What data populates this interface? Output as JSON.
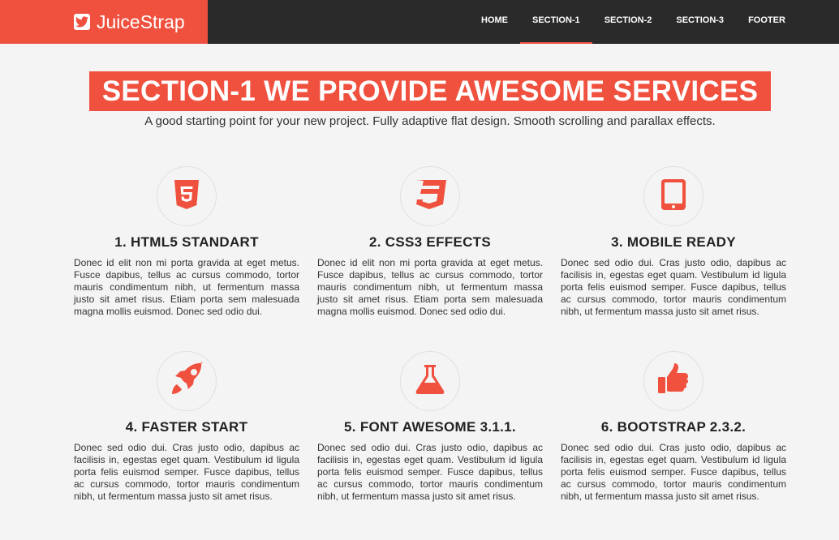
{
  "brand": {
    "name": "JuiceStrap",
    "icon": "twitter-icon"
  },
  "nav": {
    "items": [
      {
        "label": "HOME",
        "active": false
      },
      {
        "label": "SECTION-1",
        "active": true
      },
      {
        "label": "SECTION-2",
        "active": false
      },
      {
        "label": "SECTION-3",
        "active": false
      },
      {
        "label": "FOOTER",
        "active": false
      }
    ]
  },
  "hero": {
    "title": "SECTION-1 WE PROVIDE AWESOME SERVICES",
    "subtitle": "A good starting point for your new project. Fully adaptive flat design. Smooth scrolling and parallax effects."
  },
  "features": [
    {
      "icon": "html5-icon",
      "title": "1. HTML5 STANDART",
      "text": "Donec id elit non mi porta gravida at eget metus. Fusce dapibus, tellus ac cursus commodo, tortor mauris condimentum nibh, ut fermentum massa justo sit amet risus. Etiam porta sem malesuada magna mollis euismod. Donec sed odio dui."
    },
    {
      "icon": "css3-icon",
      "title": "2. CSS3 EFFECTS",
      "text": "Donec id elit non mi porta gravida at eget metus. Fusce dapibus, tellus ac cursus commodo, tortor mauris condimentum nibh, ut fermentum massa justo sit amet risus. Etiam porta sem malesuada magna mollis euismod. Donec sed odio dui."
    },
    {
      "icon": "tablet-icon",
      "title": "3. MOBILE READY",
      "text": "Donec sed odio dui. Cras justo odio, dapibus ac facilisis in, egestas eget quam. Vestibulum id ligula porta felis euismod semper. Fusce dapibus, tellus ac cursus commodo, tortor mauris condimentum nibh, ut fermentum massa justo sit amet risus."
    },
    {
      "icon": "rocket-icon",
      "title": "4. FASTER START",
      "text": "Donec sed odio dui. Cras justo odio, dapibus ac facilisis in, egestas eget quam. Vestibulum id ligula porta felis euismod semper. Fusce dapibus, tellus ac cursus commodo, tortor mauris condimentum nibh, ut fermentum massa justo sit amet risus."
    },
    {
      "icon": "flask-icon",
      "title": "5. FONT AWESOME 3.1.1.",
      "text": "Donec sed odio dui. Cras justo odio, dapibus ac facilisis in, egestas eget quam. Vestibulum id ligula porta felis euismod semper. Fusce dapibus, tellus ac cursus commodo, tortor mauris condimentum nibh, ut fermentum massa justo sit amet risus."
    },
    {
      "icon": "thumbs-up-icon",
      "title": "6. BOOTSTRAP 2.3.2.",
      "text": "Donec sed odio dui. Cras justo odio, dapibus ac facilisis in, egestas eget quam. Vestibulum id ligula porta felis euismod semper. Fusce dapibus, tellus ac cursus commodo, tortor mauris condimentum nibh, ut fermentum massa justo sit amet risus."
    }
  ],
  "colors": {
    "accent": "#f0513f",
    "navbar": "#2a2a2a",
    "background": "#f4f4f4"
  }
}
